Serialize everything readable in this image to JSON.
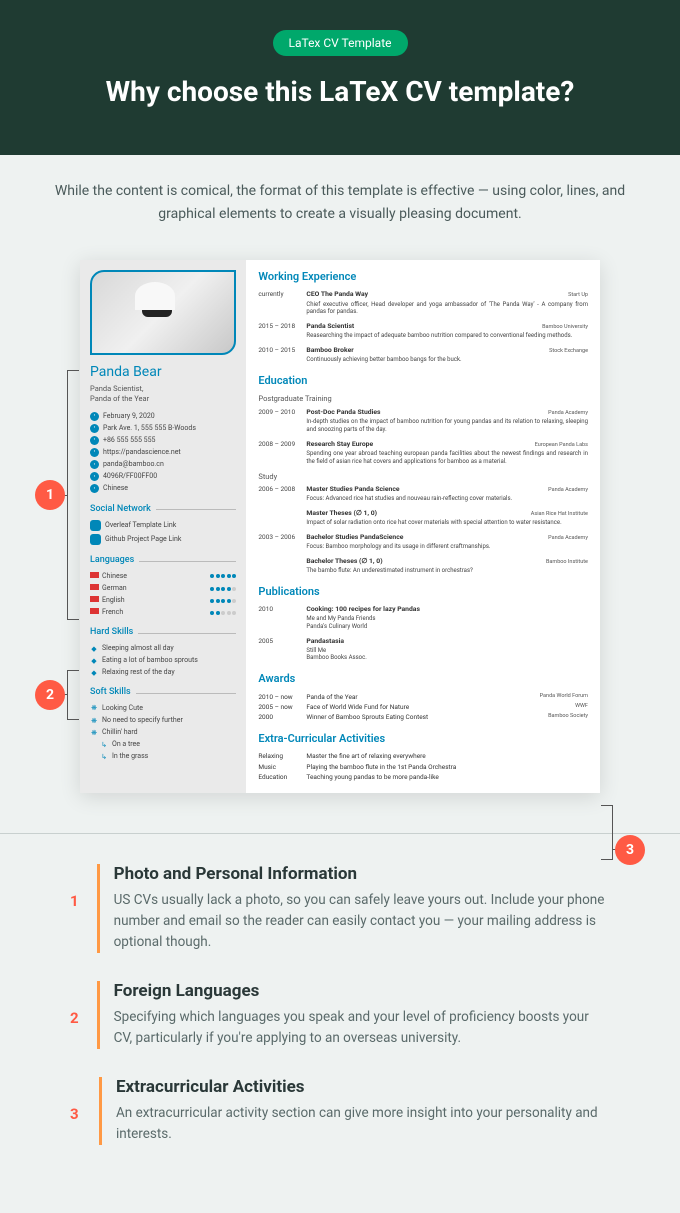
{
  "header": {
    "pill": "LaTex CV Template",
    "title": "Why choose this LaTeX CV template?"
  },
  "intro": "While the content is comical, the format of this template is effective — using color, lines, and graphical elements to create a visually pleasing document.",
  "cv": {
    "name": "Panda Bear",
    "role": "Panda Scientist,\nPanda of the Year",
    "contact": [
      "February 9, 2020",
      "Park Ave. 1, 555 555 B-Woods",
      "+86 555 555 555",
      "https://pandascience.net",
      "panda@bamboo.cn",
      "4096R/FF00FF00",
      "Chinese"
    ],
    "social_h": "Social Network",
    "social": [
      "Overleaf Template Link",
      "Github Project Page Link"
    ],
    "lang_h": "Languages",
    "lang": [
      {
        "n": "Chinese",
        "d": 5
      },
      {
        "n": "German",
        "d": 4
      },
      {
        "n": "English",
        "d": 4
      },
      {
        "n": "French",
        "d": 2
      }
    ],
    "hard_h": "Hard Skills",
    "hard": [
      "Sleeping almost all day",
      "Eating a lot of bamboo sprouts",
      "Relaxing rest of the day"
    ],
    "soft_h": "Soft Skills",
    "soft": [
      "Looking Cute",
      "No need to specify further",
      "Chillin' hard",
      "On a tree",
      "In the grass"
    ],
    "we_h": "Working Experience",
    "we": [
      {
        "d": "currently",
        "t": "CEO The Panda Way",
        "o": "Start Up",
        "x": "Chief executive officer, Head developer and yoga ambassador of 'The Panda Way' - A company from pandas for pandas."
      },
      {
        "d": "2015 – 2018",
        "t": "Panda Scientist",
        "o": "Bamboo University",
        "x": "Reasearching the impact of adequate bamboo nutrition compared to conventional feeding methods."
      },
      {
        "d": "2010 – 2015",
        "t": "Bamboo Broker",
        "o": "Stock Exchange",
        "x": "Continuously achieving better bamboo bangs for the buck."
      }
    ],
    "ed_h": "Education",
    "pg": "Postgraduate Training",
    "ed1": [
      {
        "d": "2009 – 2010",
        "t": "Post-Doc Panda Studies",
        "o": "Panda Academy",
        "x": "In-depth studies on the impact of bamboo nutrition for young pandas and its relation to relaxing, sleeping and snoozing parts of the day."
      },
      {
        "d": "2008 – 2009",
        "t": "Research Stay Europe",
        "o": "European Panda Labs",
        "x": "Spending one year abroad teaching european panda facilities about the newest findings and research in the field of asian rice hat covers and applications for bamboo as a material."
      }
    ],
    "st": "Study",
    "ed2": [
      {
        "d": "2006 – 2008",
        "t": "Master Studies Panda Science",
        "o": "Panda Academy",
        "x": "Focus: Advanced rice hat studies and nouveau rain-reflecting cover materials."
      },
      {
        "d": "",
        "t": "Master Theses (∅ 1, 0)",
        "o": "Asian Rice Hat Institute",
        "x": "Impact of solar radiation onto rice hat cover materials with special attention to water resistance."
      },
      {
        "d": "2003 – 2006",
        "t": "Bachelor Studies PandaScience",
        "o": "Panda Academy",
        "x": "Focus: Bamboo morphology and its usage in different craftmanships."
      },
      {
        "d": "",
        "t": "Bachelor Theses (∅ 1, 0)",
        "o": "Bamboo Institute",
        "x": "The bambo flute: An underestimated instrument in orchestras?"
      }
    ],
    "pub_h": "Publications",
    "pub": [
      {
        "d": "2010",
        "t": "Cooking: 100 recipes for lazy Pandas",
        "x": "Me and My Panda Friends\nPanda's Culinary World"
      },
      {
        "d": "2005",
        "t": "Pandastasia",
        "x": "Still Me\nBamboo Books Assoc."
      }
    ],
    "aw_h": "Awards",
    "aw": [
      {
        "d": "2010 – now",
        "t": "Panda of the Year",
        "o": "Panda World Forum"
      },
      {
        "d": "2005 – now",
        "t": "Face of World Wide Fund for Nature",
        "o": "WWF"
      },
      {
        "d": "2000",
        "t": "Winner of Bamboo Sprouts Eating Contest",
        "o": "Bamboo Society"
      }
    ],
    "ec_h": "Extra-Curricular Activities",
    "ec": [
      {
        "d": "Relaxing",
        "t": "Master the fine art of relaxing everywhere"
      },
      {
        "d": "Music",
        "t": "Playing the bamboo flute in the 1st Panda Orchestra"
      },
      {
        "d": "Education",
        "t": "Teaching young pandas to be more panda-like"
      }
    ]
  },
  "callouts": {
    "c1": "1",
    "c2": "2",
    "c3": "3"
  },
  "tips": [
    {
      "n": "1",
      "t": "Photo and Personal Information",
      "x": "US CVs usually lack a photo, so you can safely leave yours out. Include your phone number and email so the reader can easily contact you — your mailing address is optional though."
    },
    {
      "n": "2",
      "t": "Foreign Languages",
      "x": "Specifying which languages you speak and your level of proficiency boosts your CV, particularly if you're applying to an overseas university."
    },
    {
      "n": "3",
      "t": "Extracurricular Activities",
      "x": "An extracurricular activity section can give more insight into your personality and interests."
    }
  ]
}
